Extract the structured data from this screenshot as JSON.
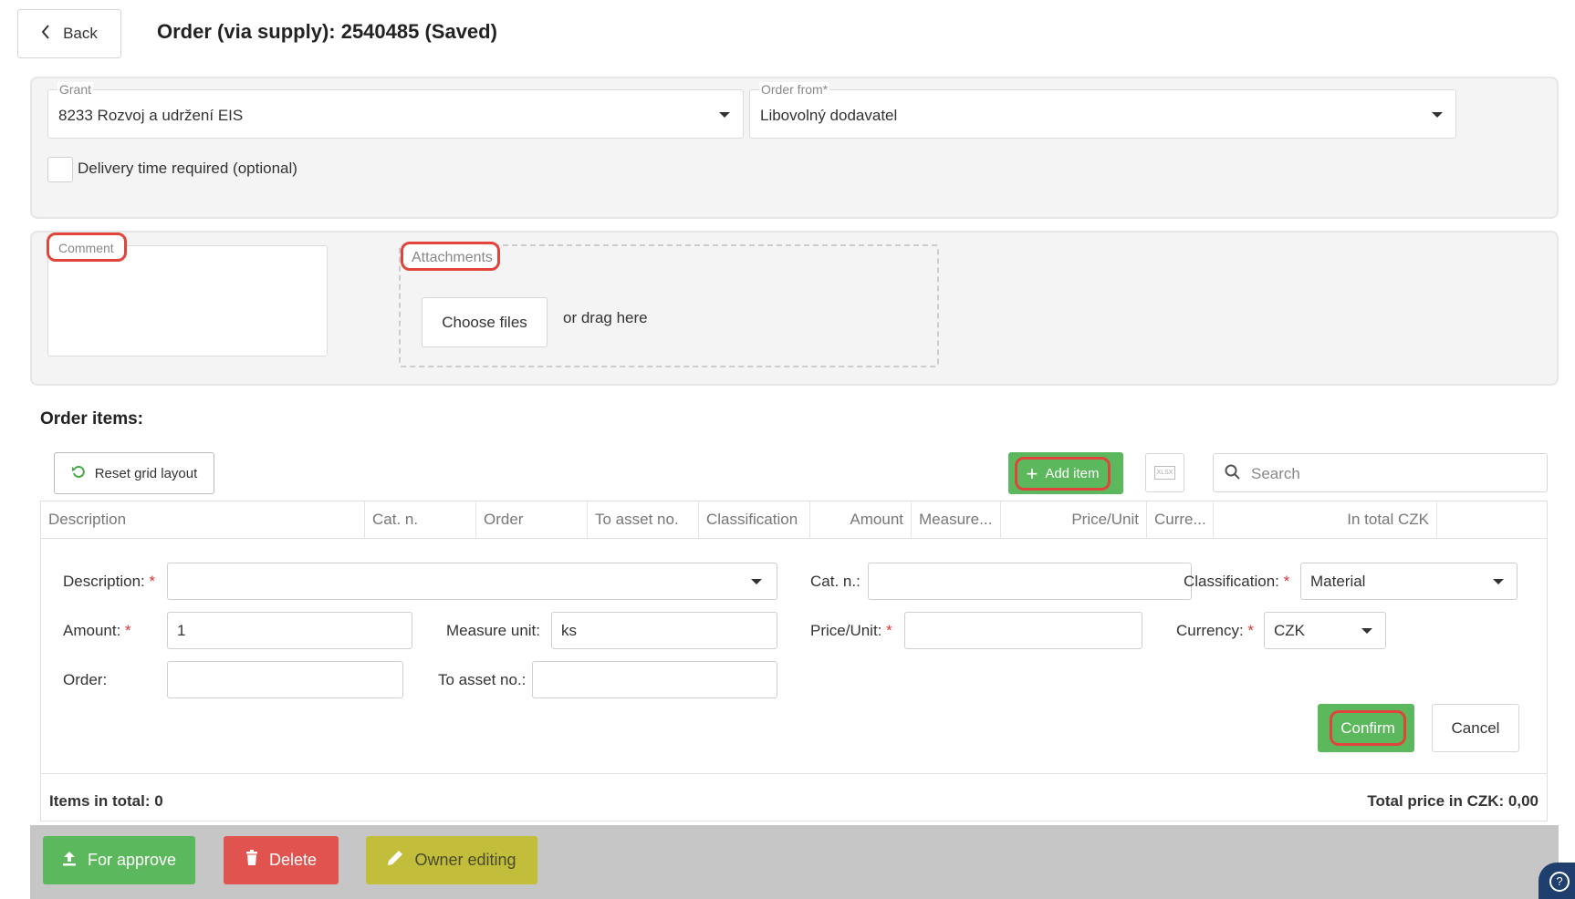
{
  "header": {
    "back_label": "Back",
    "title": "Order (via supply): 2540485 (Saved)"
  },
  "form": {
    "grant_legend": "Grant",
    "grant_value": "8233 Rozvoj a udržení EIS",
    "order_from_legend": "Order from*",
    "order_from_value": "Libovolný dodavatel",
    "delivery_label": "Delivery time required (optional)"
  },
  "comment": {
    "legend": "Comment",
    "value": ""
  },
  "attachments": {
    "legend": "Attachments",
    "choose_label": "Choose files",
    "drag_hint": "or drag here"
  },
  "items": {
    "heading": "Order items:",
    "reset_label": "Reset grid layout",
    "add_label": "Add item",
    "export_icon_text": "XLSX",
    "search_placeholder": "Search",
    "columns": [
      "Description",
      "Cat. n.",
      "Order",
      "To asset no.",
      "Classification",
      "Amount",
      "Measure...",
      "Price/Unit",
      "Curre...",
      "In total CZK"
    ]
  },
  "editor": {
    "description_label": "Description:",
    "description_value": "",
    "catn_label": "Cat. n.:",
    "catn_value": "",
    "classification_label": "Classification:",
    "classification_value": "Material",
    "amount_label": "Amount:",
    "amount_value": "1",
    "measure_label": "Measure unit:",
    "measure_value": "ks",
    "price_label": "Price/Unit:",
    "price_value": "",
    "currency_label": "Currency:",
    "currency_value": "CZK",
    "order_label": "Order:",
    "order_value": "",
    "asset_label": "To asset no.:",
    "asset_value": "",
    "confirm_label": "Confirm",
    "cancel_label": "Cancel",
    "required_mark": "*"
  },
  "summary": {
    "items_total": "Items in total: 0",
    "total_price": "Total price in CZK: 0,00"
  },
  "footer": {
    "approve_label": "For approve",
    "delete_label": "Delete",
    "owner_label": "Owner editing",
    "help_icon": "?"
  },
  "colors": {
    "green": "#5cb85c",
    "red": "#e0534f",
    "olive": "#c2bd3b",
    "highlight": "#e0443a"
  }
}
